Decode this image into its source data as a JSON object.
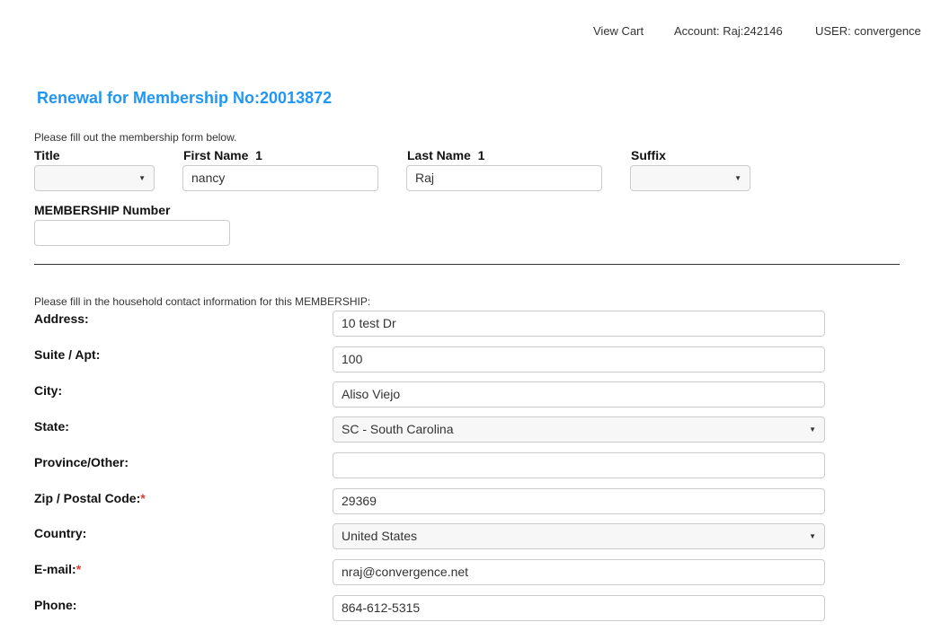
{
  "topnav": {
    "view_cart": "View Cart",
    "account": "Account: Raj:242146",
    "user": "USER: convergence"
  },
  "page": {
    "title": "Renewal for Membership No:20013872"
  },
  "member_form": {
    "instructions": "Please fill out the membership form below.",
    "title_label": "Title",
    "title_value": "",
    "first_name_label": "First Name",
    "first_name_marker": "1",
    "first_name_value": "nancy",
    "last_name_label": "Last Name",
    "last_name_marker": "1",
    "last_name_value": "Raj",
    "suffix_label": "Suffix",
    "suffix_value": "",
    "membership_number_label": "MEMBERSHIP Number",
    "membership_number_value": ""
  },
  "contact_form": {
    "instructions": "Please fill in the household contact information for this MEMBERSHIP:",
    "address_label": "Address:",
    "address_value": "10 test Dr",
    "suite_label": "Suite / Apt:",
    "suite_value": "100",
    "city_label": "City:",
    "city_value": "Aliso Viejo",
    "state_label": "State:",
    "state_value": "SC - South Carolina",
    "province_label": "Province/Other:",
    "province_value": "",
    "zip_label": "Zip / Postal Code:",
    "zip_value": "29369",
    "country_label": "Country:",
    "country_value": "United States",
    "email_label": "E-mail:",
    "email_value": "nraj@convergence.net",
    "phone_label": "Phone:",
    "phone_value": "864-612-5315",
    "required_marker": "*"
  },
  "colors": {
    "title_blue": "#2196f3",
    "required_red": "#e53935"
  },
  "icons": {
    "select_caret": "chevron-down-icon"
  }
}
